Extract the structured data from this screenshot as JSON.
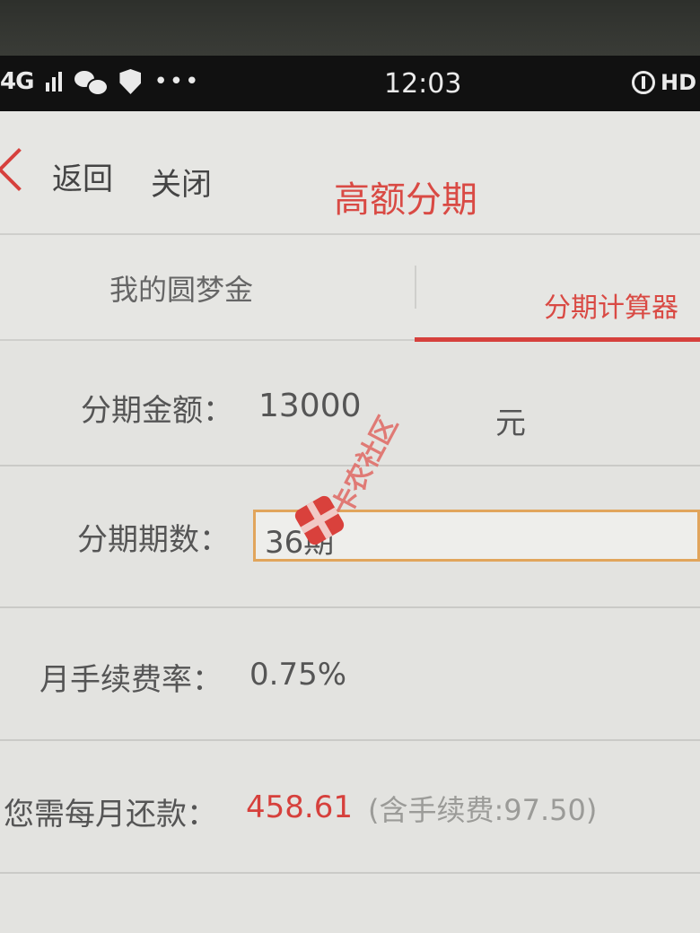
{
  "status_bar": {
    "network": "4G",
    "dots": "•••",
    "time": "12:03",
    "right_label": "HD"
  },
  "nav": {
    "back_label": "返回",
    "close_label": "关闭",
    "title": "高额分期"
  },
  "tabs": [
    {
      "label": "我的圆梦金",
      "active": false
    },
    {
      "label": "分期计算器",
      "active": true
    }
  ],
  "form": {
    "amount_label": "分期金额：",
    "amount_value": "13000",
    "amount_unit": "元",
    "periods_label": "分期期数：",
    "periods_value": "36期",
    "rate_label": "月手续费率：",
    "rate_value": "0.75%",
    "payment_label": "您需每月还款：",
    "payment_value": "458.61",
    "payment_fee_note": "(含手续费:97.50)"
  },
  "watermark": {
    "text": "卡农社区"
  },
  "colors": {
    "accent": "#d6403c",
    "input_border": "#e1a55c",
    "background": "#e4e4e1"
  }
}
